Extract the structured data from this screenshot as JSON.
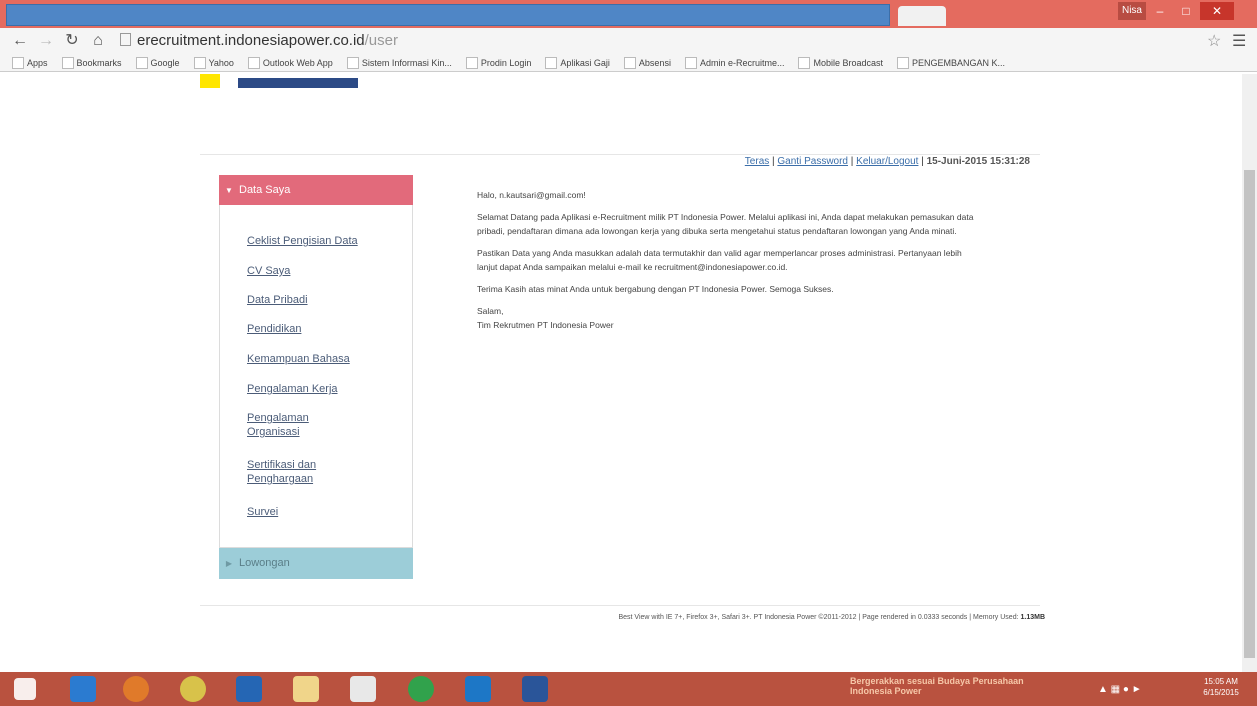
{
  "browser": {
    "user_name": "Nisa",
    "url_host": "erecruitment.indonesiapower.co.id",
    "url_path": "/user",
    "bookmarks": [
      {
        "label": "Apps"
      },
      {
        "label": "Bookmarks"
      },
      {
        "label": "Google"
      },
      {
        "label": "Yahoo"
      },
      {
        "label": "Outlook Web App"
      },
      {
        "label": "Sistem Informasi Kin..."
      },
      {
        "label": "Prodin Login"
      },
      {
        "label": "Aplikasi Gaji"
      },
      {
        "label": "Absensi"
      },
      {
        "label": "Admin e-Recruitme..."
      },
      {
        "label": "Mobile Broadcast"
      },
      {
        "label": "PENGEMBANGAN K..."
      }
    ]
  },
  "topnav": {
    "teras": "Teras",
    "ganti_password": "Ganti Password",
    "keluar": "Keluar/Logout",
    "sep": " | ",
    "datetime": "15-Juni-2015 15:31:28"
  },
  "sidebar": {
    "header": "Data Saya",
    "items": [
      {
        "label": "Ceklist Pengisian Data"
      },
      {
        "label": "CV Saya"
      },
      {
        "label": "Data Pribadi"
      },
      {
        "label": "Pendidikan"
      },
      {
        "label": "Kemampuan Bahasa"
      },
      {
        "label": "Pengalaman Kerja"
      },
      {
        "label": "Pengalaman Organisasi"
      },
      {
        "label": "Sertifikasi dan Penghargaan"
      },
      {
        "label": "Survei"
      }
    ],
    "footer": "Lowongan"
  },
  "content": {
    "greeting": "Halo, n.kautsari@gmail.com!",
    "p1": "Selamat Datang pada Aplikasi e-Recruitment milik PT Indonesia Power. Melalui aplikasi ini, Anda dapat melakukan pemasukan data pribadi, pendaftaran dimana ada lowongan kerja yang dibuka serta mengetahui status pendaftaran lowongan yang Anda minati.",
    "p2": "Pastikan Data yang Anda masukkan adalah data termutakhir dan valid agar memperlancar proses administrasi. Pertanyaan lebih lanjut dapat Anda sampaikan melalui e-mail ke recruitment@indonesiapower.co.id.",
    "p3": "Terima Kasih atas minat Anda untuk bergabung dengan PT Indonesia Power. Semoga Sukses.",
    "salam": "Salam,",
    "signature": "Tim Rekrutmen PT Indonesia Power"
  },
  "footer": {
    "text": "Best View with IE 7+, Firefox 3+, Safari 3+. PT Indonesia Power ©2011-2012 | Page rendered in 0.0333 seconds | Memory Used:",
    "memory": "1.13MB"
  },
  "taskbar": {
    "tray_text": "Bergerakkan sesuai Budaya Perusahaan Indonesia Power",
    "clock_time": "15:05 AM",
    "clock_date": "6/15/2015"
  },
  "colors": {
    "sidebar_header": "#e26a7b",
    "sidebar_footer": "#9ccdd8",
    "link": "#3b6ea9",
    "taskbar": "#b9523f"
  }
}
